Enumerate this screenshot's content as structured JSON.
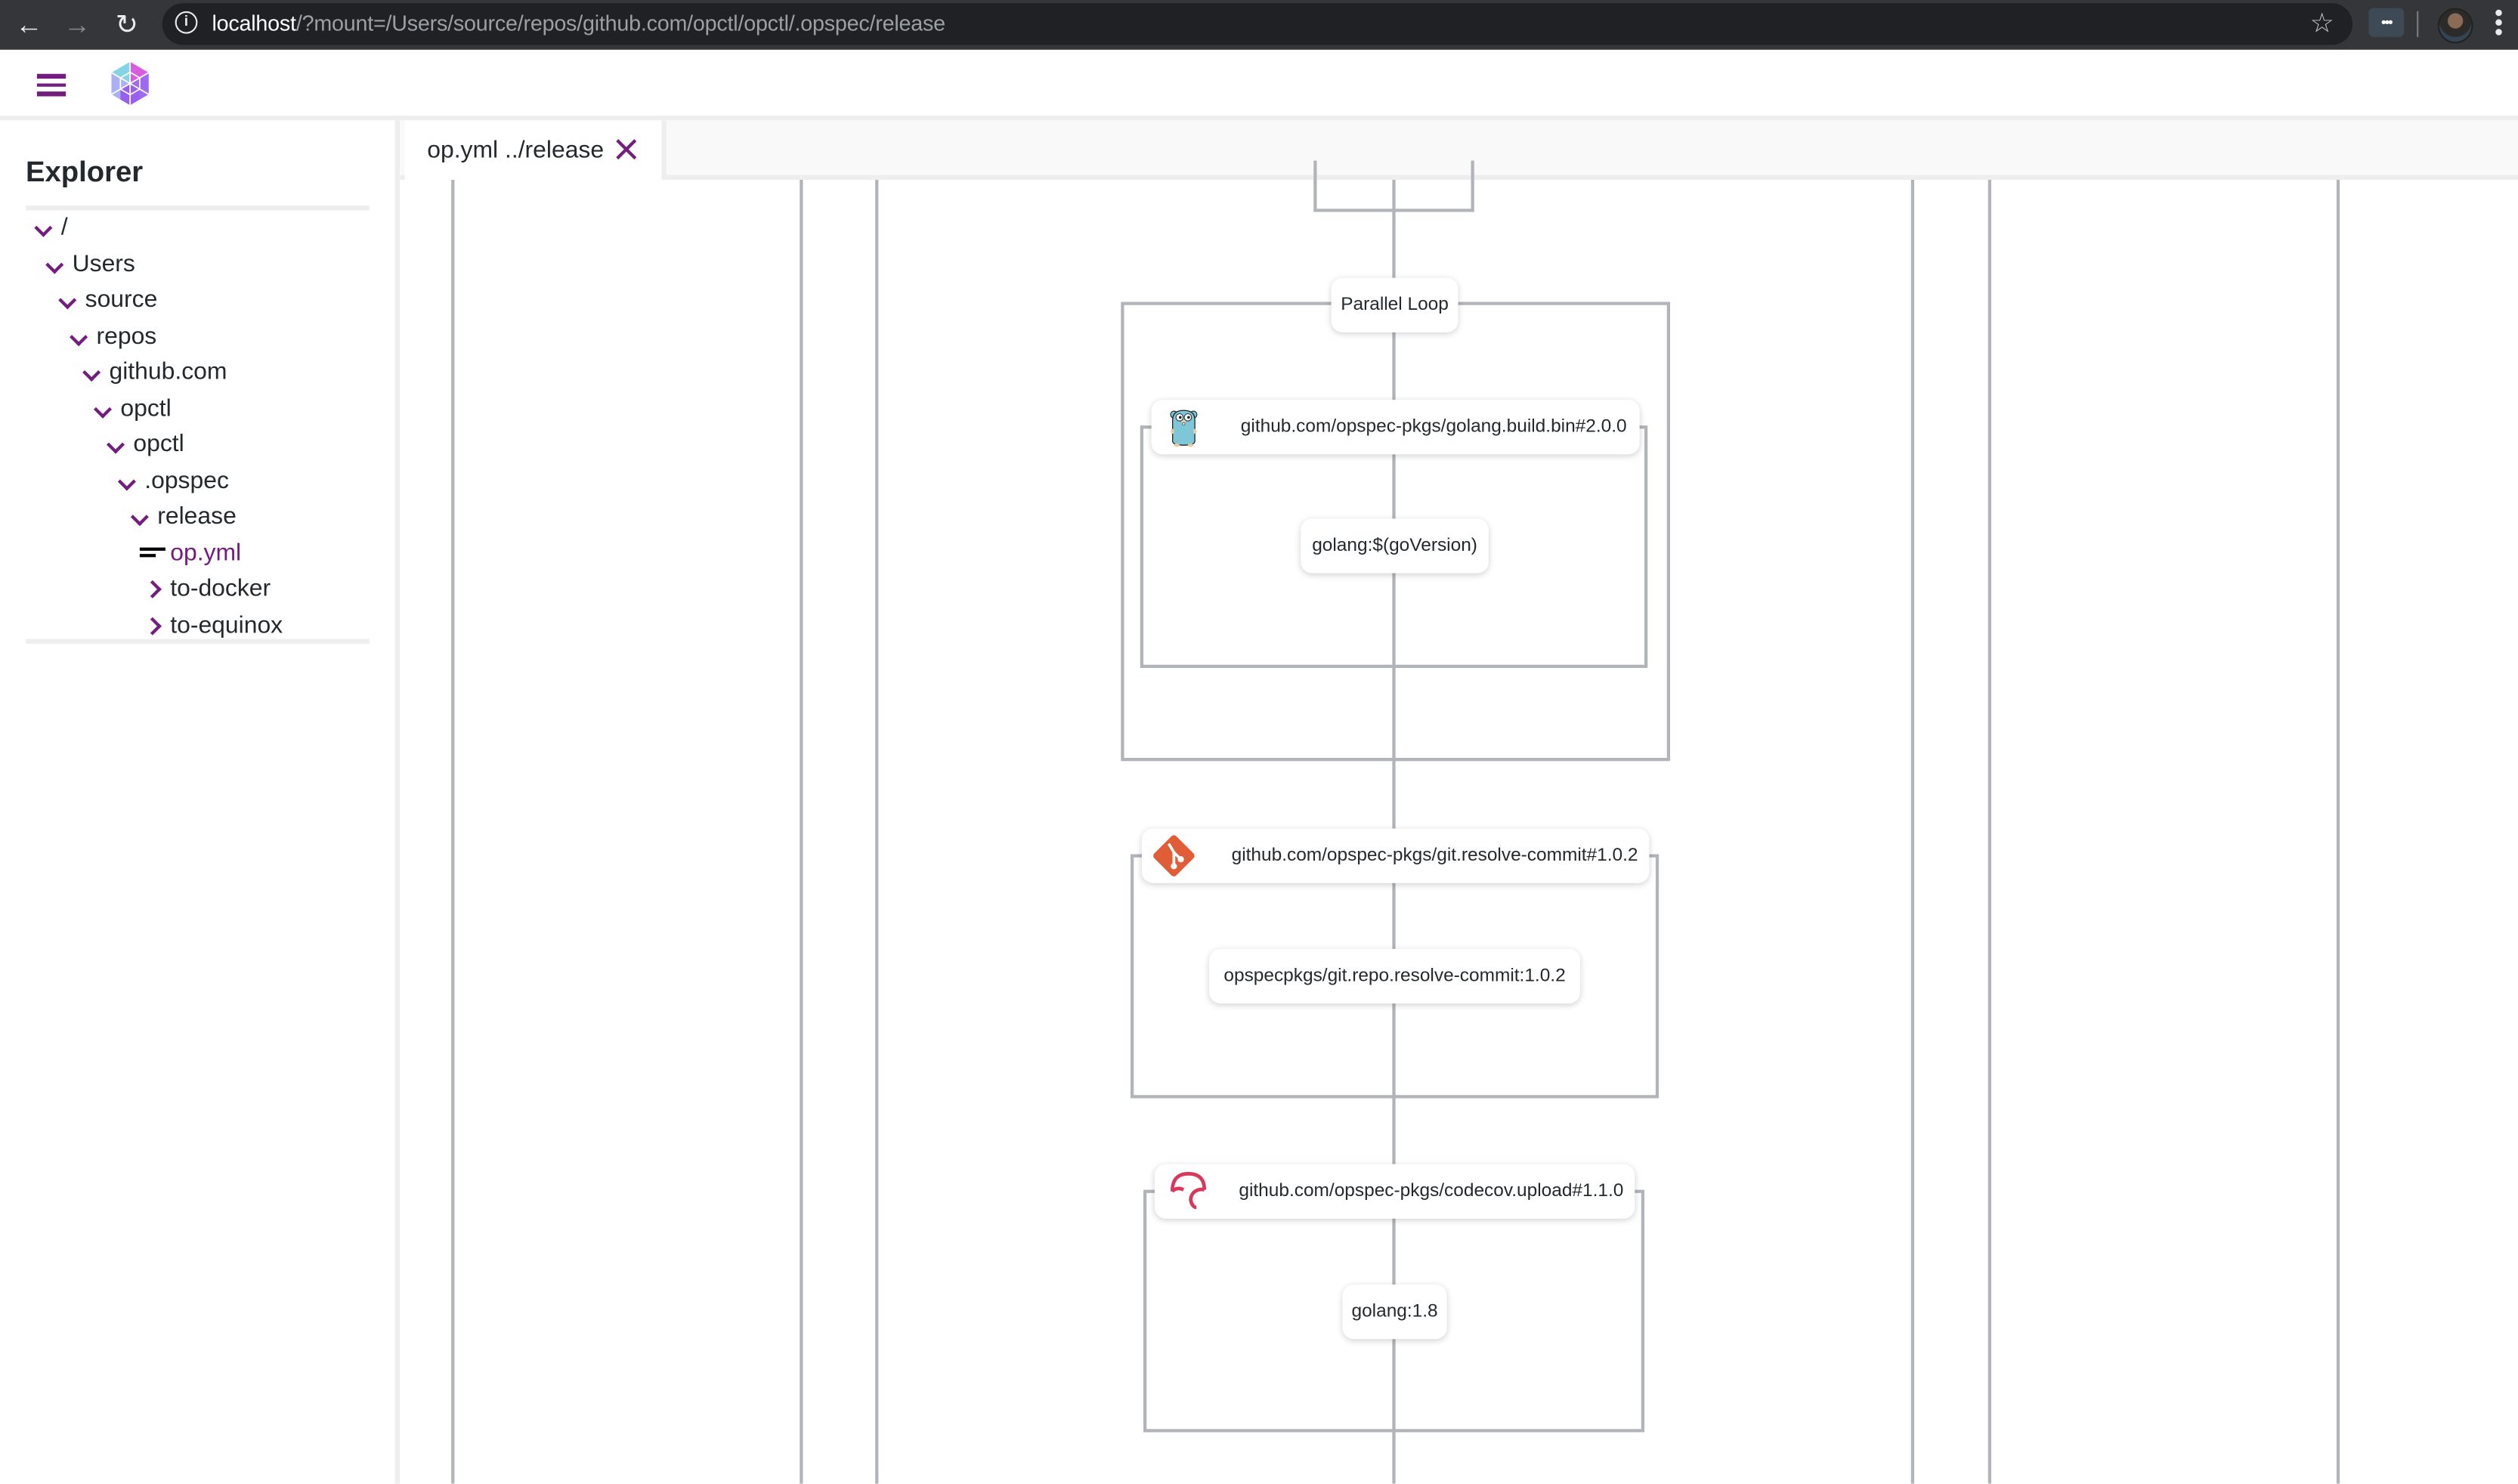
{
  "browser": {
    "url_host": "localhost",
    "url_rest": "/?mount=/Users/source/repos/github.com/opctl/opctl/.opspec/release",
    "back_icon": "arrow-left-icon",
    "forward_icon": "arrow-right-icon",
    "reload_icon": "reload-icon",
    "info_icon": "info-icon",
    "bookmark_icon": "star-icon",
    "extension_label": "•••",
    "menu_icon": "kebab-menu-icon"
  },
  "app": {
    "menu_icon": "hamburger-menu-icon",
    "logo_icon": "opctl-logo-icon",
    "accent_color": "#751c80"
  },
  "sidebar": {
    "title": "Explorer",
    "tree": [
      {
        "label": "/",
        "state": "expanded",
        "depth": 0
      },
      {
        "label": "Users",
        "state": "expanded",
        "depth": 1
      },
      {
        "label": "source",
        "state": "expanded",
        "depth": 2
      },
      {
        "label": "repos",
        "state": "expanded",
        "depth": 3
      },
      {
        "label": "github.com",
        "state": "expanded",
        "depth": 4
      },
      {
        "label": "opctl",
        "state": "expanded",
        "depth": 5
      },
      {
        "label": "opctl",
        "state": "expanded",
        "depth": 6
      },
      {
        "label": ".opspec",
        "state": "expanded",
        "depth": 7
      },
      {
        "label": "release",
        "state": "expanded",
        "depth": 8
      },
      {
        "label": "op.yml",
        "state": "file-selected",
        "depth": 9
      },
      {
        "label": "to-docker",
        "state": "collapsed",
        "depth": 9
      },
      {
        "label": "to-equinox",
        "state": "collapsed",
        "depth": 9
      }
    ]
  },
  "tabs": [
    {
      "label": "op.yml ../release",
      "active": true,
      "close_icon": "close-icon"
    }
  ],
  "diagram": {
    "parallel_loop": {
      "label": "Parallel Loop"
    },
    "ops": [
      {
        "ref": "github.com/opspec-pkgs/golang.build.bin#2.0.0",
        "icon": "gopher-icon",
        "container": "golang:$(goVersion)"
      },
      {
        "ref": "github.com/opspec-pkgs/git.resolve-commit#1.0.2",
        "icon": "git-icon",
        "container": "opspecpkgs/git.repo.resolve-commit:1.0.2"
      },
      {
        "ref": "github.com/opspec-pkgs/codecov.upload#1.1.0",
        "icon": "codecov-icon",
        "container": "golang:1.8"
      }
    ],
    "line_color": "#b1b5bb"
  }
}
